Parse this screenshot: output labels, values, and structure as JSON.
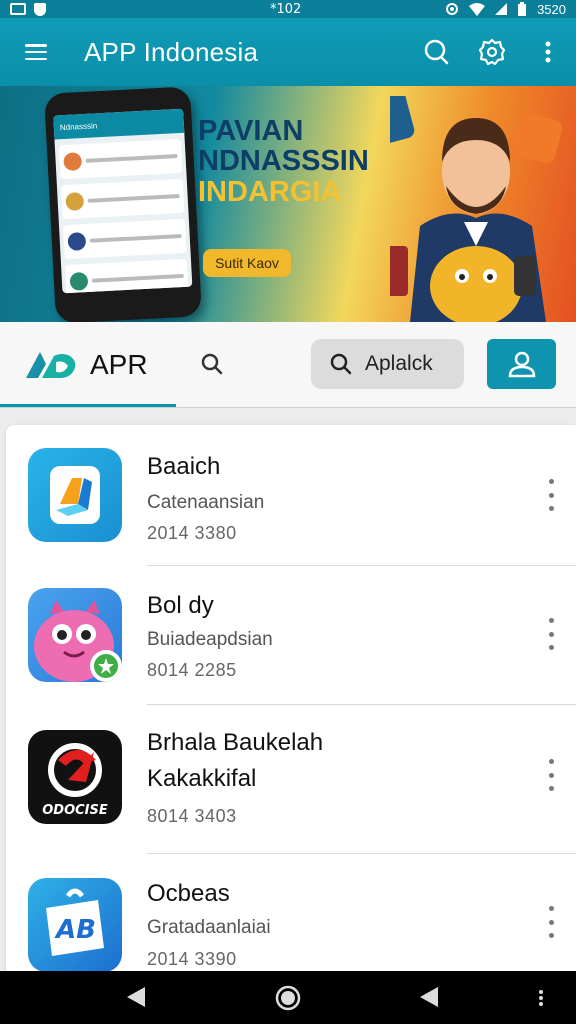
{
  "status_bar": {
    "center_text": "*102",
    "time": "3520",
    "icons": [
      "photo-icon",
      "shield-icon",
      "location-icon",
      "wifi-icon",
      "signal-icon",
      "battery-icon"
    ]
  },
  "app_bar": {
    "title": "APP Indonesia",
    "menu_icon": "hamburger-icon",
    "actions": [
      "search-icon",
      "settings-icon",
      "more-vert-icon"
    ]
  },
  "banner": {
    "headline_line1": "PAVIAN",
    "headline_line2": "NDNASSSIN",
    "headline_line3": "INDARGIA",
    "cta_label": "Sutit Kaov",
    "phone_header": "Ndnasssin"
  },
  "tab_bar": {
    "logo_text": "APR",
    "search_chip_label": "Aplalck",
    "icons": [
      "search-icon",
      "profile-icon"
    ]
  },
  "apps": [
    {
      "name": "Baaich",
      "subtitle": "Catenaansian",
      "date": "2014 3380",
      "icon": "blocks-app-icon"
    },
    {
      "name": "Bol dy",
      "subtitle": "Buiadeapdsian",
      "date": "8014 2285",
      "icon": "monster-app-icon"
    },
    {
      "name_line1": "Brhala Baukelah",
      "name_line2": "Kakakkifal",
      "date": "8014 3403",
      "icon": "odocise-app-icon",
      "icon_text": "ODOCISE"
    },
    {
      "name": "Ocbeas",
      "subtitle": "Gratadaanlaiai",
      "date": "2014 3390",
      "icon": "ab-app-icon",
      "icon_text": "AB"
    }
  ],
  "colors": {
    "primary": "#0e94ae",
    "status_bar": "#0b7f99",
    "accent_yellow": "#f0b82a"
  }
}
